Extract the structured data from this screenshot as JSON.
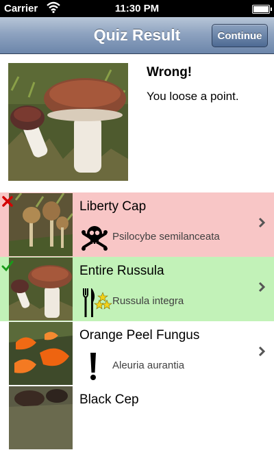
{
  "status_bar": {
    "carrier": "Carrier",
    "time": "11:30 PM",
    "wifi_icon": "wifi-icon",
    "battery_icon": "battery-icon"
  },
  "nav": {
    "title": "Quiz Result",
    "continue_label": "Continue"
  },
  "result": {
    "title": "Wrong!",
    "message": "You loose a point."
  },
  "list": {
    "items": [
      {
        "name": "Liberty Cap",
        "latin": "Psilocybe semilanceata",
        "status": "incorrect",
        "mark_icon": "red-x-icon",
        "edibility_icon": "skull-crossbones-icon",
        "bg": "#f8c6c6"
      },
      {
        "name": "Entire Russula",
        "latin": "Russula integra",
        "status": "correct",
        "mark_icon": "green-check-icon",
        "edibility_icon": "fork-knife-stars-icon",
        "bg": "#c2f2b8"
      },
      {
        "name": "Orange Peel Fungus",
        "latin": "Aleuria aurantia",
        "status": "neutral",
        "edibility_icon": "exclamation-icon",
        "bg": "#ffffff"
      },
      {
        "name": "Black Cep",
        "status": "neutral",
        "bg": "#ffffff"
      }
    ]
  },
  "colors": {
    "nav_gradient_top": "#b8c6d8",
    "nav_gradient_bottom": "#6c86aa",
    "wrong_row": "#f8c6c6",
    "correct_row": "#c2f2b8"
  }
}
